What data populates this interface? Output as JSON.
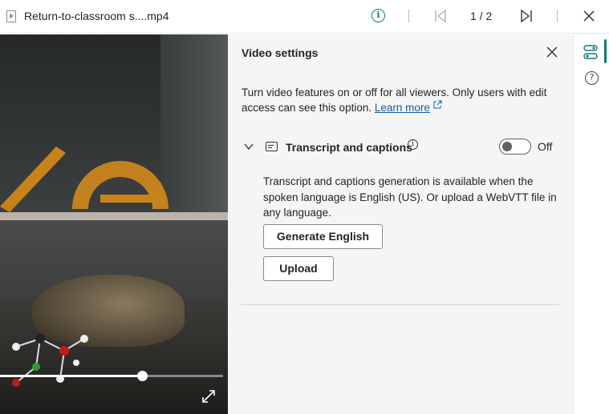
{
  "header": {
    "file_name": "Return-to-classroom s....mp4",
    "info_icon": "info-icon",
    "page_indicator": "1 / 2",
    "first_icon": "skip-first-icon",
    "last_icon": "skip-last-icon",
    "close_icon": "close-icon"
  },
  "video": {
    "progress": 0.64,
    "expand_icon": "fullscreen-expand-icon"
  },
  "panel": {
    "title": "Video settings",
    "description": "Turn video features on or off for all viewers. Only users with edit access can see this option.",
    "learn_more": "Learn more",
    "section": {
      "title": "Transcript and captions",
      "toggle_state": "Off",
      "description": "Transcript and captions generation is available when the spoken language is English (US). Or upload a WebVTT file in any language.",
      "generate_button": "Generate English",
      "upload_button": "Upload"
    }
  },
  "rail": {
    "settings_icon": "settings-toggles-icon",
    "help_icon": "help-icon",
    "help_glyph": "?"
  },
  "colors": {
    "accent": "#0f7b6c",
    "link": "#115ea3",
    "panel_bg": "#f5f5f5"
  }
}
